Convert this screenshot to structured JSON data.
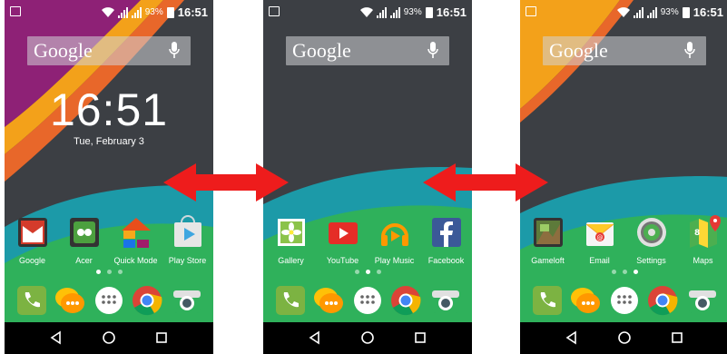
{
  "colors": {
    "arrow": "#ee1c1c",
    "wallpaper_base": "#3c3f44",
    "teal": "#1c9aa8",
    "green": "#2fb15b",
    "orange": "#f3a11a",
    "magenta": "#8e2176"
  },
  "status": {
    "battery": "93%",
    "time": "16:51"
  },
  "search": {
    "logo": "Google"
  },
  "lock": {
    "time": "16:51",
    "date": "Tue, February 3"
  },
  "screens": [
    {
      "apps": [
        {
          "label": "Google",
          "icon": "google-folder-icon"
        },
        {
          "label": "Acer",
          "icon": "acer-folder-icon"
        },
        {
          "label": "Quick Mode",
          "icon": "quick-mode-icon"
        },
        {
          "label": "Play Store",
          "icon": "play-store-icon"
        }
      ],
      "active_page": 0
    },
    {
      "apps": [
        {
          "label": "Gallery",
          "icon": "gallery-icon"
        },
        {
          "label": "YouTube",
          "icon": "youtube-icon"
        },
        {
          "label": "Play Music",
          "icon": "play-music-icon"
        },
        {
          "label": "Facebook",
          "icon": "facebook-icon"
        }
      ],
      "active_page": 1
    },
    {
      "apps": [
        {
          "label": "Gameloft",
          "icon": "gameloft-icon"
        },
        {
          "label": "Email",
          "icon": "email-icon"
        },
        {
          "label": "Settings",
          "icon": "settings-icon"
        },
        {
          "label": "Maps",
          "icon": "maps-icon"
        }
      ],
      "active_page": 2
    }
  ],
  "dock": [
    "phone-icon",
    "messaging-icon",
    "app-drawer-icon",
    "chrome-icon",
    "camera-icon"
  ],
  "navbar": [
    "back-icon",
    "home-icon",
    "recents-icon"
  ]
}
